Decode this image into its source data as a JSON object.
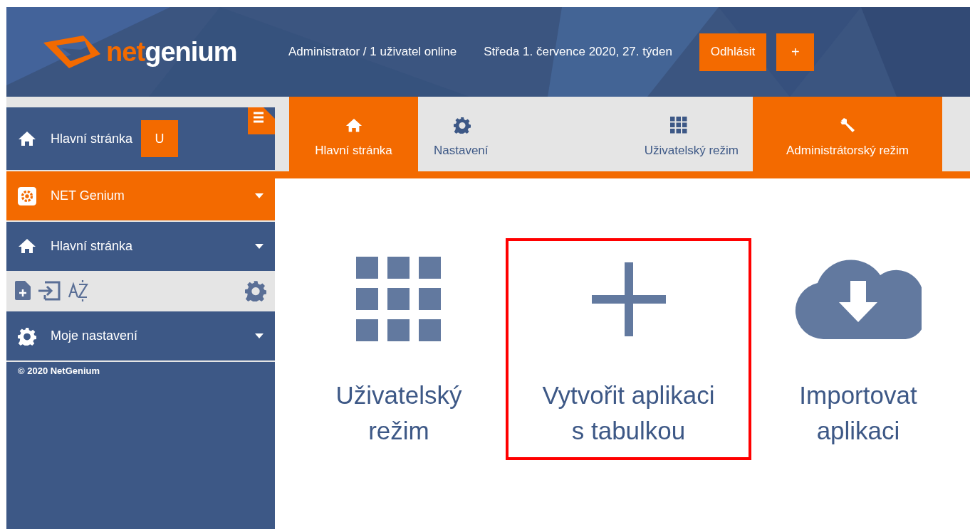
{
  "header": {
    "logo": [
      "net",
      "genium"
    ],
    "user_info": "Administrator / 1 uživatel online",
    "date": "Středa 1. července 2020, 27. týden",
    "buttons": [
      "Odhlásit",
      "+"
    ]
  },
  "sidebar": {
    "home": {
      "label": "Hlavní stránka",
      "badge": "U"
    },
    "items": [
      {
        "kind": "app",
        "label": "NET Genium",
        "selected": true
      },
      {
        "kind": "home",
        "label": "Hlavní stránka",
        "selected": false
      },
      {
        "kind": "toolbar"
      },
      {
        "kind": "settings",
        "label": "Moje nastavení",
        "selected": false
      }
    ],
    "footer": "© 2020 NetGenium"
  },
  "tabs": [
    {
      "kind": "home",
      "label": "Hlavní stránka",
      "selected": true
    },
    {
      "kind": "settings",
      "label": "Nastavení",
      "selected": false
    },
    {
      "kind": "grid",
      "label": "Uživatelský režim",
      "selected": false
    },
    {
      "kind": "wrench",
      "label": "Administrátorský režim",
      "selected": true
    }
  ],
  "tiles": [
    {
      "kind": "grid",
      "label": [
        "Uživatelský",
        "režim"
      ],
      "highlighted": false
    },
    {
      "kind": "plus",
      "label": [
        "Vytvořit aplikaci",
        "s tabulkou"
      ],
      "highlighted": true
    },
    {
      "kind": "cloud",
      "label": [
        "Importovat",
        "aplikaci"
      ],
      "highlighted": false
    }
  ]
}
